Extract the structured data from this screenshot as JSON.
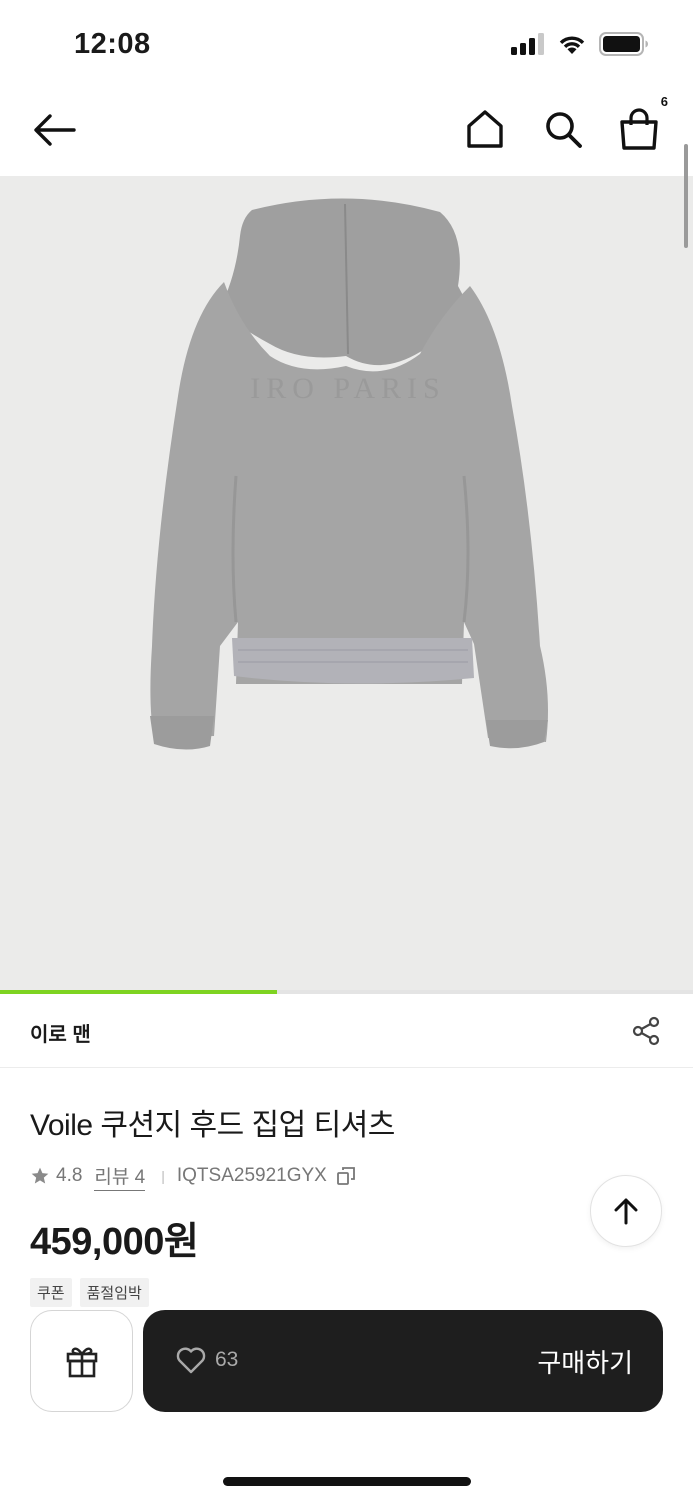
{
  "status_bar": {
    "time": "12:08"
  },
  "nav": {
    "cart_count": "6"
  },
  "gallery": {
    "image_alt": "grey hoodie back view",
    "embossed_text": "IRO PARIS",
    "progress": 0.4
  },
  "brand": {
    "name": "이로 맨"
  },
  "product": {
    "title": "Voile 쿠션지 후드 집업 티셔츠",
    "rating": "4.8",
    "review_label": "리뷰 4",
    "code": "IQTSA25921GYX",
    "price": "459,000원",
    "tags": [
      "쿠폰",
      "품절임박"
    ]
  },
  "actions": {
    "like_count": "63",
    "buy_label": "구매하기"
  },
  "colors": {
    "accent_progress": "#7ed321",
    "buy_button_bg": "#1e1e1e",
    "gallery_bg": "#ebebea"
  }
}
